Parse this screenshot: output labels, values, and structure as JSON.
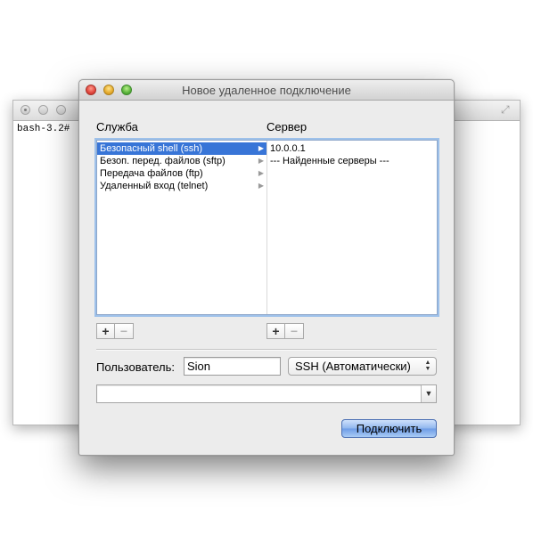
{
  "terminal": {
    "prompt": "bash-3.2#"
  },
  "dialog": {
    "title": "Новое удаленное подключение",
    "service_header": "Служба",
    "server_header": "Сервер",
    "services": [
      "Безопасный shell (ssh)",
      "Безоп. перед. файлов (sftp)",
      "Передача файлов (ftp)",
      "Удаленный вход (telnet)"
    ],
    "selected_service_index": 0,
    "servers": [
      "10.0.0.1",
      "--- Найденные серверы ---"
    ],
    "add_label": "+",
    "remove_label": "−",
    "user_label": "Пользователь:",
    "user_value": "Sion",
    "protocol_value": "SSH (Автоматически)",
    "command_value": "",
    "connect_label": "Подключить"
  },
  "colors": {
    "selection": "#3875d7",
    "focus_ring": "#9ec1ea",
    "dialog_bg": "#ececec"
  },
  "icons": {
    "close": "close-icon",
    "minimize": "minimize-icon",
    "zoom": "zoom-icon",
    "disclosure": "disclosure-arrow-icon",
    "resize": "fullscreen-icon"
  }
}
